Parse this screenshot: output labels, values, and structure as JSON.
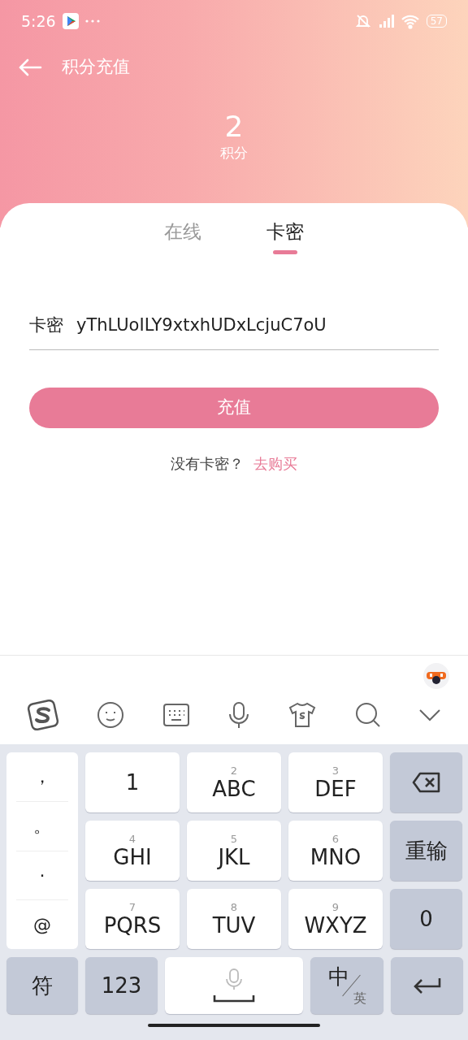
{
  "status_bar": {
    "time": "5:26",
    "battery": "57"
  },
  "header": {
    "title": "积分充值",
    "points": "2",
    "points_label": "积分"
  },
  "tabs": [
    {
      "label": "在线",
      "selected": false
    },
    {
      "label": "卡密",
      "selected": true
    }
  ],
  "card_field": {
    "label": "卡密",
    "value": "yThLUoILY9xtxhUDxLcjuC7oU"
  },
  "submit_button": "充值",
  "buy_hint": {
    "text": "没有卡密？",
    "link": "去购买"
  },
  "keyboard": {
    "punctuation": [
      "，",
      "。",
      "·",
      "@"
    ],
    "keys": [
      {
        "kind": "key",
        "main": "1"
      },
      {
        "kind": "key",
        "sub": "2",
        "main": "ABC"
      },
      {
        "kind": "key",
        "sub": "3",
        "main": "DEF"
      },
      {
        "kind": "backspace"
      },
      {
        "kind": "key",
        "sub": "4",
        "main": "GHI"
      },
      {
        "kind": "key",
        "sub": "5",
        "main": "JKL"
      },
      {
        "kind": "key",
        "sub": "6",
        "main": "MNO"
      },
      {
        "kind": "func",
        "main": "重输"
      },
      {
        "kind": "key",
        "sub": "7",
        "main": "PQRS"
      },
      {
        "kind": "key",
        "sub": "8",
        "main": "TUV"
      },
      {
        "kind": "key",
        "sub": "9",
        "main": "WXYZ"
      },
      {
        "kind": "func",
        "main": "0"
      }
    ],
    "bottom": [
      {
        "kind": "func",
        "main": "符"
      },
      {
        "kind": "func",
        "main": "123"
      },
      {
        "kind": "space"
      },
      {
        "kind": "lang",
        "main": "中",
        "sub": "英"
      },
      {
        "kind": "enter"
      }
    ]
  }
}
